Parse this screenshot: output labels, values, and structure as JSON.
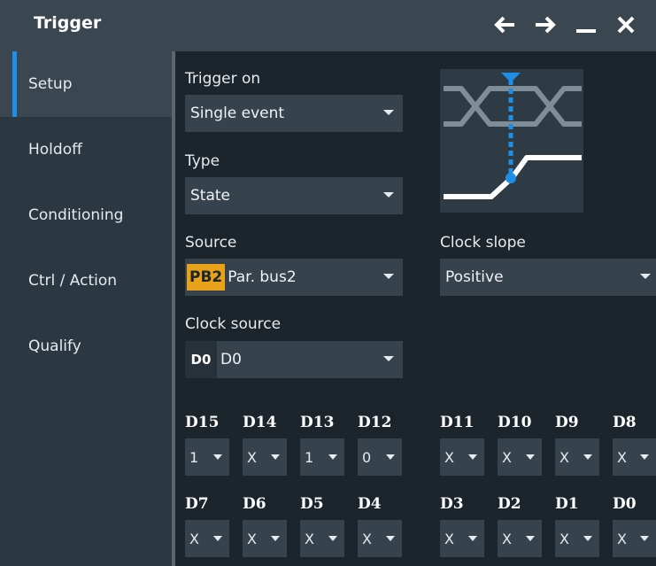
{
  "window": {
    "title": "Trigger"
  },
  "titlebar_icons": [
    "arrow-left-icon",
    "arrow-right-icon",
    "minimize-icon",
    "close-icon"
  ],
  "sidebar": {
    "items": [
      {
        "label": "Setup",
        "active": true
      },
      {
        "label": "Holdoff",
        "active": false
      },
      {
        "label": "Conditioning",
        "active": false
      },
      {
        "label": "Ctrl / Action",
        "active": false
      },
      {
        "label": "Qualify",
        "active": false
      }
    ]
  },
  "setup": {
    "trigger_on": {
      "label": "Trigger on",
      "value": "Single event"
    },
    "type": {
      "label": "Type",
      "value": "State"
    },
    "source": {
      "label": "Source",
      "badge": "PB2",
      "value": "Par. bus2"
    },
    "clock_slope": {
      "label": "Clock slope",
      "value": "Positive"
    },
    "clock_source": {
      "label": "Clock source",
      "badge": "D0",
      "value": "D0"
    }
  },
  "bits_row1": [
    {
      "label": "D15",
      "value": "1"
    },
    {
      "label": "D14",
      "value": "X"
    },
    {
      "label": "D13",
      "value": "1"
    },
    {
      "label": "D12",
      "value": "0"
    },
    {
      "label": "D11",
      "value": "X"
    },
    {
      "label": "D10",
      "value": "X"
    },
    {
      "label": "D9",
      "value": "X"
    },
    {
      "label": "D8",
      "value": "X"
    }
  ],
  "bits_row2": [
    {
      "label": "D7",
      "value": "X"
    },
    {
      "label": "D6",
      "value": "X"
    },
    {
      "label": "D5",
      "value": "X"
    },
    {
      "label": "D4",
      "value": "X"
    },
    {
      "label": "D3",
      "value": "X"
    },
    {
      "label": "D2",
      "value": "X"
    },
    {
      "label": "D1",
      "value": "X"
    },
    {
      "label": "D0",
      "value": "X"
    }
  ],
  "colors": {
    "accent": "#1e8ee6",
    "bus_badge": "#e8a21a",
    "background": "#1c252c",
    "sidebar": "#2b3741",
    "titlebar": "#3a4650"
  }
}
